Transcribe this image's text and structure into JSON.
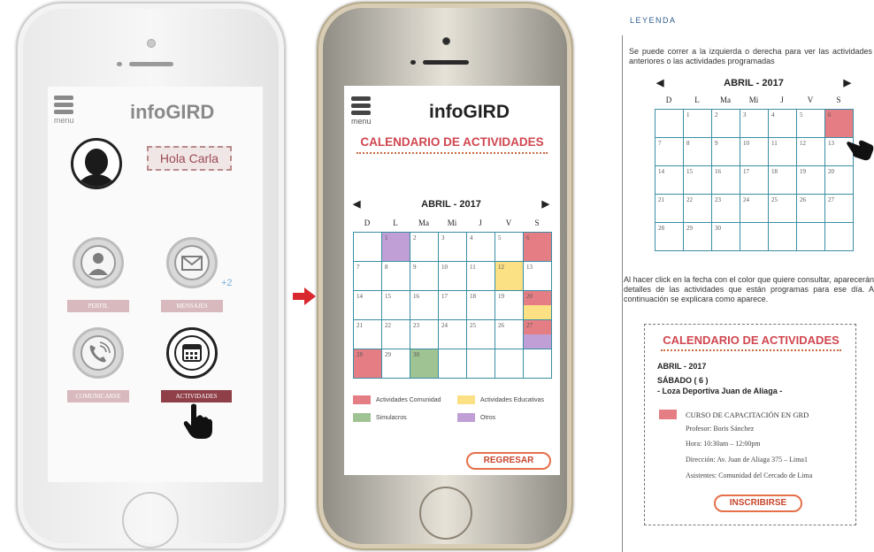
{
  "app": {
    "logo": "infoGIRD",
    "menu_label": "menu"
  },
  "screen1": {
    "greeting": "Hola Carla",
    "tiles": [
      {
        "label": "PERFIL",
        "icon": "profile-icon"
      },
      {
        "label": "MENSAJES",
        "icon": "envelope-icon",
        "badge": "+2"
      },
      {
        "label": "COMUNICARSE",
        "icon": "phone-icon"
      },
      {
        "label": "ACTIVIDADES",
        "icon": "calendar-icon",
        "active": true
      }
    ]
  },
  "calendar": {
    "title": "CALENDARIO DE ACTIVIDADES",
    "month": "ABRIL - 2017",
    "weekdays": [
      "D",
      "L",
      "Ma",
      "Mi",
      "J",
      "V",
      "S"
    ],
    "weeks": [
      [
        "",
        "1",
        "2",
        "3",
        "4",
        "5",
        "6"
      ],
      [
        "7",
        "8",
        "9",
        "10",
        "11",
        "12",
        "13"
      ],
      [
        "14",
        "15",
        "16",
        "17",
        "18",
        "19",
        "20"
      ],
      [
        "21",
        "22",
        "23",
        "24",
        "25",
        "26",
        "27"
      ],
      [
        "28",
        "29",
        "30",
        "",
        "",
        "",
        ""
      ]
    ],
    "colors": {
      "comunidad": "#e57e84",
      "educativas": "#fbe084",
      "simulacros": "#9fc393",
      "otros": "#bf9fd6"
    },
    "events": {
      "1": [
        "otros"
      ],
      "6": [
        "comunidad"
      ],
      "12": [
        "educativas"
      ],
      "20": [
        "comunidad",
        "educativas"
      ],
      "27": [
        "comunidad",
        "otros"
      ],
      "28": [
        "comunidad"
      ],
      "30": [
        "simulacros"
      ]
    },
    "legend": [
      {
        "key": "comunidad",
        "label": "Actividades Comunidad"
      },
      {
        "key": "educativas",
        "label": "Actividades Educativas"
      },
      {
        "key": "simulacros",
        "label": "Simulacros"
      },
      {
        "key": "otros",
        "label": "Otros"
      }
    ],
    "back_button": "REGRESAR"
  },
  "legend_panel": {
    "heading": "LEYENDA",
    "intro": "Se puede correr a la izquierda o derecha para ver las actividades anteriores o las actividades programadas",
    "explain": "Al hacer click en la fecha con el color que quiere consultar, aparecerán detalles de las actividades que están programas para ese día. A continuación se explicara como aparece.",
    "mini_events": {
      "6": [
        "comunidad"
      ]
    },
    "detail": {
      "title": "CALENDARIO DE ACTIVIDADES",
      "month": "ABRIL - 2017",
      "day": "SÁBADO ( 6 )",
      "place": "- Loza Deportiva Juan de Aliaga -",
      "course": "CURSO DE CAPACITACIÓN EN GRD",
      "professor": "Profesor: Boris Sánchez",
      "time": "Hora: 10:30am – 12:00pm",
      "address": "Dirección: Av. Juan de Aliaga 375 – Lima1",
      "attendees": "Asistentes: Comunidad del Cercado de Lima",
      "button": "INSCRIBIRSE"
    }
  }
}
